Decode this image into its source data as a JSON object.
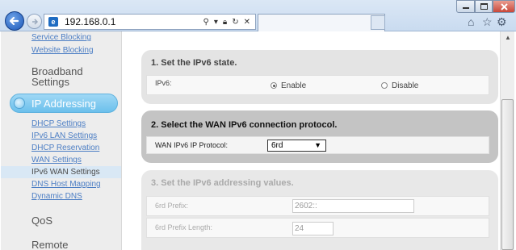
{
  "browser": {
    "address": "192.168.0.1",
    "address_icons": [
      "search-icon",
      "dropdown-icon",
      "lock-icon",
      "refresh-icon",
      "stop-icon"
    ]
  },
  "sidebar": {
    "top_links": [
      "Service Blocking",
      "Website Blocking"
    ],
    "broadband_heading": "Broadband Settings",
    "ip_addressing": "IP Addressing",
    "ip_links": [
      {
        "label": "DHCP Settings",
        "active": false
      },
      {
        "label": "IPv6 LAN Settings",
        "active": false
      },
      {
        "label": "DHCP Reservation",
        "active": false
      },
      {
        "label": "WAN Settings",
        "active": false
      },
      {
        "label": "IPv6 WAN Settings",
        "active": true
      },
      {
        "label": "DNS Host Mapping",
        "active": false
      },
      {
        "label": "Dynamic DNS",
        "active": false
      }
    ],
    "qos_heading": "QoS",
    "remote_heading": "Remote"
  },
  "section1": {
    "title": "1. Set the IPv6 state.",
    "label": "IPv6:",
    "option_enable": "Enable",
    "option_disable": "Disable",
    "selected": "Enable"
  },
  "section2": {
    "title": "2. Select the WAN IPv6 connection protocol.",
    "label": "WAN IPv6 IP Protocol:",
    "selected_value": "6rd"
  },
  "section3": {
    "title": "3. Set the IPv6 addressing values.",
    "prefix_label": "6rd Prefix:",
    "prefix_value": "2602::",
    "prefix_length_label": "6rd Prefix Length:",
    "prefix_length_value": "24"
  },
  "colors": {
    "accent": "#6cc0ec",
    "link": "#4c7ec4",
    "section_active": "#c4c4c4",
    "section_inactive": "#e4e4e4"
  }
}
